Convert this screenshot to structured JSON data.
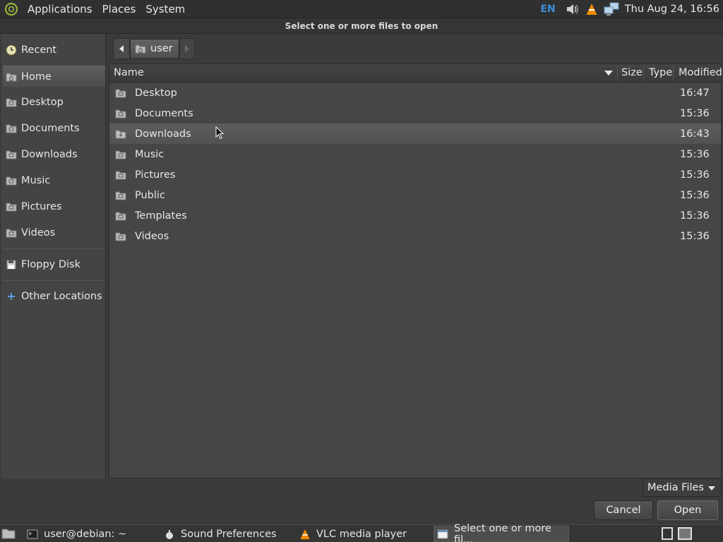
{
  "top_panel": {
    "menus": [
      "Applications",
      "Places",
      "System"
    ],
    "language": "EN",
    "clock": "Thu Aug 24, 16:56",
    "icons": [
      "debian-logo-icon",
      "volume-icon",
      "vlc-icon",
      "network-icon"
    ]
  },
  "dialog": {
    "title": "Select one or more files to open"
  },
  "sidebar": {
    "items": [
      {
        "label": "Recent",
        "icon": "recent-icon"
      },
      {
        "label": "Home",
        "icon": "home-folder-icon",
        "active": true
      },
      {
        "label": "Desktop",
        "icon": "folder-icon"
      },
      {
        "label": "Documents",
        "icon": "folder-icon"
      },
      {
        "label": "Downloads",
        "icon": "folder-icon"
      },
      {
        "label": "Music",
        "icon": "folder-icon"
      },
      {
        "label": "Pictures",
        "icon": "folder-icon"
      },
      {
        "label": "Videos",
        "icon": "folder-icon"
      },
      {
        "label": "Floppy Disk",
        "icon": "floppy-icon"
      },
      {
        "label": "Other Locations",
        "icon": "plus-icon"
      }
    ]
  },
  "pathbar": {
    "crumb": "user"
  },
  "filelist": {
    "columns": {
      "name": "Name",
      "size": "Size",
      "type": "Type",
      "modified": "Modified"
    },
    "rows": [
      {
        "name": "Desktop",
        "modified": "16:47"
      },
      {
        "name": "Documents",
        "modified": "15:36"
      },
      {
        "name": "Downloads",
        "modified": "16:43",
        "selected": true
      },
      {
        "name": "Music",
        "modified": "15:36"
      },
      {
        "name": "Pictures",
        "modified": "15:36"
      },
      {
        "name": "Public",
        "modified": "15:36"
      },
      {
        "name": "Templates",
        "modified": "15:36"
      },
      {
        "name": "Videos",
        "modified": "15:36"
      }
    ]
  },
  "footer": {
    "filter": "Media Files",
    "cancel": "Cancel",
    "open": "Open"
  },
  "taskbar": {
    "tasks": [
      {
        "label": "user@debian: ~",
        "icon": "terminal-icon"
      },
      {
        "label": "Sound Preferences",
        "icon": "sound-prefs-icon"
      },
      {
        "label": "VLC media player",
        "icon": "vlc-icon"
      },
      {
        "label": "Select one or more fil...",
        "icon": "window-icon",
        "active": true
      }
    ]
  },
  "colors": {
    "background": "#3b3b3b",
    "panel": "#303030",
    "selection": "#5c5c5c",
    "accent_lang": "#3d8fd9",
    "vlc_orange": "#f08a00"
  }
}
